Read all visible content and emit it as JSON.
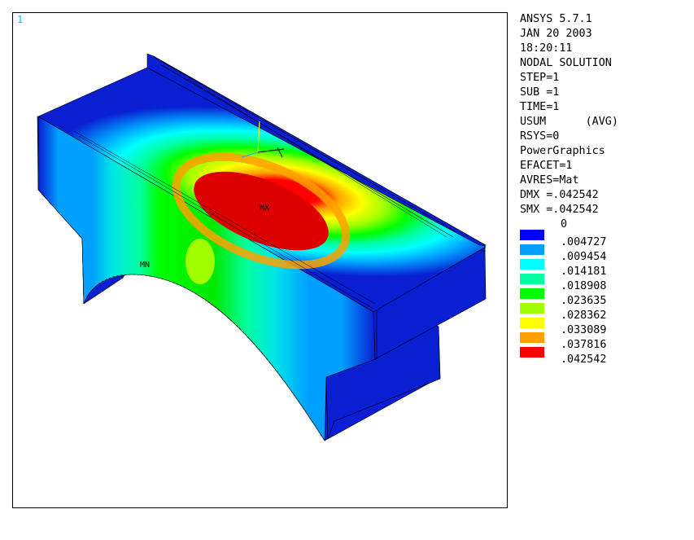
{
  "window_number": "1",
  "header": {
    "lines": [
      "ANSYS 5.7.1",
      "JAN 20 2003",
      "18:20:11",
      "NODAL SOLUTION",
      "STEP=1",
      "SUB =1",
      "TIME=1",
      "USUM      (AVG)",
      "RSYS=0",
      "PowerGraphics",
      "EFACET=1",
      "AVRES=Mat",
      "DMX =.042542",
      "SMX =.042542"
    ]
  },
  "legend": {
    "min_label": "0",
    "bands": [
      {
        "label": ".004727",
        "color": "#0000ff"
      },
      {
        "label": ".009454",
        "color": "#00a0ff"
      },
      {
        "label": ".014181",
        "color": "#00ffff"
      },
      {
        "label": ".018908",
        "color": "#00ffa0"
      },
      {
        "label": ".023635",
        "color": "#00ff00"
      },
      {
        "label": ".028362",
        "color": "#a0ff00"
      },
      {
        "label": ".033089",
        "color": "#ffff00"
      },
      {
        "label": ".037816",
        "color": "#ffa000"
      },
      {
        "label": ".042542",
        "color": "#ff0000"
      }
    ]
  },
  "markers": {
    "max": "MX",
    "min": "MN"
  },
  "colors": {
    "background": "#ffffff",
    "frame": "#000000",
    "window_number": "#00c8d8",
    "triad": "#00c8d8",
    "triad_y": "#ffff00",
    "edge": "#000000"
  }
}
